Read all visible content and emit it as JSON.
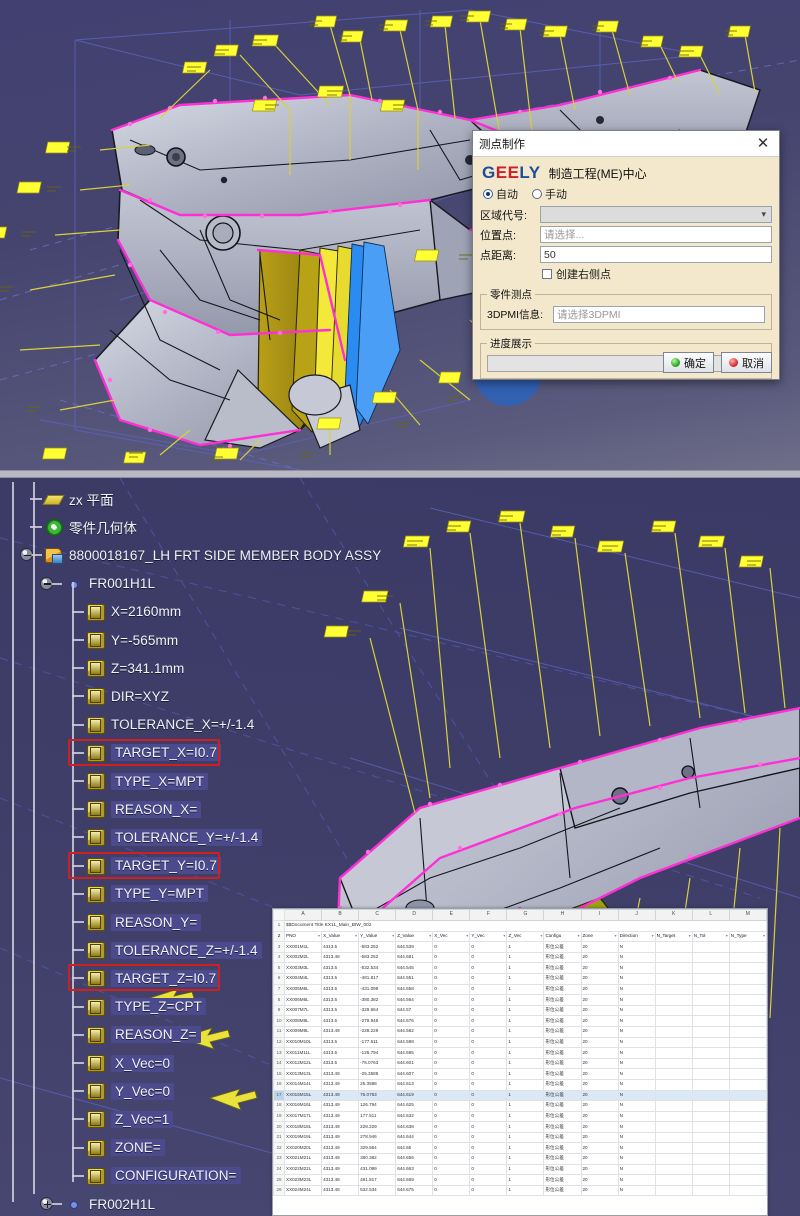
{
  "app": {
    "viewport_top_name": "3d-cad-viewport-top",
    "viewport_bottom_name": "3d-cad-viewport-bottom"
  },
  "dialog": {
    "title": "测点制作",
    "close_label": "✕",
    "brand": "GEELY",
    "brand_cn": "制造工程(ME)中心",
    "mode_auto": "自动",
    "mode_manual": "手动",
    "mode_selected": "自动",
    "zone_label": "区域代号:",
    "zone_value": "",
    "pos_label": "位置点:",
    "pos_placeholder": "请选择...",
    "dist_label": "点距离:",
    "dist_value": "50",
    "create_right_label": "创建右侧点",
    "part_group_label": "零件测点",
    "pmi_label": "3DPMI信息:",
    "pmi_placeholder": "请选择3DPMI",
    "progress_group_label": "进度展示",
    "ok_label": "确定",
    "cancel_label": "取消"
  },
  "tree": {
    "items": [
      {
        "label": "zx 平面",
        "icon": "plane-icon",
        "depth": 1,
        "node": "none",
        "sel": false,
        "red": false
      },
      {
        "label": "零件几何体",
        "icon": "body-icon",
        "depth": 1,
        "node": "none",
        "sel": false,
        "red": false
      },
      {
        "label": "8800018167_LH FRT SIDE MEMBER BODY ASSY",
        "icon": "assembly-icon",
        "depth": 1,
        "node": "minus",
        "sel": false,
        "red": false
      },
      {
        "label": "FR001H1L",
        "icon": "point-icon",
        "depth": 2,
        "node": "minus",
        "sel": false,
        "red": false
      },
      {
        "label": "X=2160mm",
        "icon": "attribute-icon",
        "depth": 3,
        "node": "none",
        "sel": false,
        "red": false
      },
      {
        "label": "Y=-565mm",
        "icon": "attribute-icon",
        "depth": 3,
        "node": "none",
        "sel": false,
        "red": false
      },
      {
        "label": "Z=341.1mm",
        "icon": "attribute-icon",
        "depth": 3,
        "node": "none",
        "sel": false,
        "red": false
      },
      {
        "label": "DIR=XYZ",
        "icon": "attribute-icon",
        "depth": 3,
        "node": "none",
        "sel": false,
        "red": false
      },
      {
        "label": "TOLERANCE_X=+/-1.4",
        "icon": "attribute-icon",
        "depth": 3,
        "node": "none",
        "sel": false,
        "red": false
      },
      {
        "label": "TARGET_X=I0.7",
        "icon": "attribute-icon",
        "depth": 3,
        "node": "none",
        "sel": true,
        "red": true
      },
      {
        "label": "TYPE_X=MPT",
        "icon": "attribute-icon",
        "depth": 3,
        "node": "none",
        "sel": true,
        "red": false
      },
      {
        "label": "REASON_X=",
        "icon": "attribute-icon",
        "depth": 3,
        "node": "none",
        "sel": true,
        "red": false
      },
      {
        "label": "TOLERANCE_Y=+/-1.4",
        "icon": "attribute-icon",
        "depth": 3,
        "node": "none",
        "sel": true,
        "red": false
      },
      {
        "label": "TARGET_Y=I0.7",
        "icon": "attribute-icon",
        "depth": 3,
        "node": "none",
        "sel": true,
        "red": true
      },
      {
        "label": "TYPE_Y=MPT",
        "icon": "attribute-icon",
        "depth": 3,
        "node": "none",
        "sel": true,
        "red": false
      },
      {
        "label": "REASON_Y=",
        "icon": "attribute-icon",
        "depth": 3,
        "node": "none",
        "sel": true,
        "red": false
      },
      {
        "label": "TOLERANCE_Z=+/-1.4",
        "icon": "attribute-icon",
        "depth": 3,
        "node": "none",
        "sel": true,
        "red": false
      },
      {
        "label": "TARGET_Z=I0.7",
        "icon": "attribute-icon",
        "depth": 3,
        "node": "none",
        "sel": true,
        "red": true
      },
      {
        "label": "TYPE_Z=CPT",
        "icon": "attribute-icon",
        "depth": 3,
        "node": "none",
        "sel": true,
        "red": false
      },
      {
        "label": "REASON_Z=",
        "icon": "attribute-icon",
        "depth": 3,
        "node": "none",
        "sel": true,
        "red": false
      },
      {
        "label": "X_Vec=0",
        "icon": "attribute-icon",
        "depth": 3,
        "node": "none",
        "sel": true,
        "red": false
      },
      {
        "label": "Y_Vec=0",
        "icon": "attribute-icon",
        "depth": 3,
        "node": "none",
        "sel": true,
        "red": false
      },
      {
        "label": "Z_Vec=1",
        "icon": "attribute-icon",
        "depth": 3,
        "node": "none",
        "sel": true,
        "red": false
      },
      {
        "label": "ZONE=",
        "icon": "attribute-icon",
        "depth": 3,
        "node": "none",
        "sel": true,
        "red": false
      },
      {
        "label": "CONFIGURATION=",
        "icon": "attribute-icon",
        "depth": 3,
        "node": "none",
        "sel": true,
        "red": false
      },
      {
        "label": "FR002H1L",
        "icon": "point-icon",
        "depth": 2,
        "node": "plus",
        "sel": false,
        "red": false
      }
    ]
  },
  "sheet": {
    "columns": [
      "A",
      "B",
      "C",
      "D",
      "E",
      "F",
      "G",
      "H",
      "I",
      "J",
      "K",
      "L",
      "M"
    ],
    "title_row": "$$Document Title KX11_Main_BIW_002",
    "headers": [
      "PNO",
      "X_Value",
      "Y_Value",
      "Z_Value",
      "X_Vec",
      "Y_Vec",
      "Z_Vec",
      "Configu",
      "Zone",
      "Direction",
      "N_Target",
      "N_Tol",
      "N_Type"
    ],
    "selected_row": 17,
    "rows": [
      {
        "n": 3,
        "cells": [
          "XX001M1L",
          "4313.5",
          "-583.252",
          "644.539",
          "0",
          "0",
          "1",
          "形位公差",
          "20",
          "N",
          "",
          "",
          ""
        ]
      },
      {
        "n": 4,
        "cells": [
          "XX002M2L",
          "4313.48",
          "-583.252",
          "644.681",
          "0",
          "0",
          "1",
          "形位公差",
          "20",
          "N",
          "",
          "",
          ""
        ]
      },
      {
        "n": 5,
        "cells": [
          "XX003M3L",
          "4313.5",
          "-532.534",
          "644.545",
          "0",
          "0",
          "1",
          "形位公差",
          "20",
          "N",
          "",
          "",
          ""
        ]
      },
      {
        "n": 6,
        "cells": [
          "XX004M4L",
          "4313.5",
          "-481.817",
          "644.551",
          "0",
          "0",
          "1",
          "形位公差",
          "20",
          "N",
          "",
          "",
          ""
        ]
      },
      {
        "n": 7,
        "cells": [
          "XX005M5L",
          "4313.5",
          "-431.099",
          "644.558",
          "0",
          "0",
          "1",
          "形位公差",
          "20",
          "N",
          "",
          "",
          ""
        ]
      },
      {
        "n": 8,
        "cells": [
          "XX006M6L",
          "4313.5",
          "-380.382",
          "644.564",
          "0",
          "0",
          "1",
          "形位公差",
          "20",
          "N",
          "",
          "",
          ""
        ]
      },
      {
        "n": 9,
        "cells": [
          "XX007M7L",
          "4313.5",
          "-329.664",
          "644.57",
          "0",
          "0",
          "1",
          "形位公差",
          "20",
          "N",
          "",
          "",
          ""
        ]
      },
      {
        "n": 10,
        "cells": [
          "XX008M8L",
          "4313.5",
          "-279.946",
          "644.576",
          "0",
          "0",
          "1",
          "形位公差",
          "20",
          "N",
          "",
          "",
          ""
        ]
      },
      {
        "n": 11,
        "cells": [
          "XX009M9L",
          "4313.49",
          "-228.229",
          "644.582",
          "0",
          "0",
          "1",
          "形位公差",
          "20",
          "N",
          "",
          "",
          ""
        ]
      },
      {
        "n": 12,
        "cells": [
          "XX010M10L",
          "4313.5",
          "-177.511",
          "644.588",
          "0",
          "0",
          "1",
          "形位公差",
          "20",
          "N",
          "",
          "",
          ""
        ]
      },
      {
        "n": 13,
        "cells": [
          "XX011M11L",
          "4313.5",
          "-126.794",
          "644.595",
          "0",
          "0",
          "1",
          "形位公差",
          "20",
          "N",
          "",
          "",
          ""
        ]
      },
      {
        "n": 14,
        "cells": [
          "XX012M12L",
          "4313.5",
          "-76.0763",
          "644.601",
          "0",
          "0",
          "1",
          "形位公差",
          "20",
          "N",
          "",
          "",
          ""
        ]
      },
      {
        "n": 15,
        "cells": [
          "XX013M13L",
          "4313.49",
          "-25.3588",
          "644.607",
          "0",
          "0",
          "1",
          "形位公差",
          "20",
          "N",
          "",
          "",
          ""
        ]
      },
      {
        "n": 16,
        "cells": [
          "XX014M14L",
          "4313.49",
          "25.3588",
          "644.613",
          "0",
          "0",
          "1",
          "形位公差",
          "20",
          "N",
          "",
          "",
          ""
        ]
      },
      {
        "n": 17,
        "cells": [
          "XX015M15L",
          "4313.49",
          "76.0763",
          "644.619",
          "0",
          "0",
          "1",
          "形位公差",
          "20",
          "N",
          "",
          "",
          ""
        ]
      },
      {
        "n": 18,
        "cells": [
          "XX016M16L",
          "4313.49",
          "126.794",
          "644.625",
          "0",
          "0",
          "1",
          "形位公差",
          "20",
          "N",
          "",
          "",
          ""
        ]
      },
      {
        "n": 19,
        "cells": [
          "XX017M17L",
          "4313.49",
          "177.511",
          "644.632",
          "0",
          "0",
          "1",
          "形位公差",
          "20",
          "N",
          "",
          "",
          ""
        ]
      },
      {
        "n": 20,
        "cells": [
          "XX018M18L",
          "4313.49",
          "228.229",
          "644.638",
          "0",
          "0",
          "1",
          "形位公差",
          "20",
          "N",
          "",
          "",
          ""
        ]
      },
      {
        "n": 21,
        "cells": [
          "XX019M19L",
          "4313.49",
          "278.946",
          "644.644",
          "0",
          "0",
          "1",
          "形位公差",
          "20",
          "N",
          "",
          "",
          ""
        ]
      },
      {
        "n": 22,
        "cells": [
          "XX020M20L",
          "4313.49",
          "329.664",
          "644.65",
          "0",
          "0",
          "1",
          "形位公差",
          "20",
          "N",
          "",
          "",
          ""
        ]
      },
      {
        "n": 23,
        "cells": [
          "XX021M21L",
          "4313.49",
          "380.382",
          "644.656",
          "0",
          "0",
          "1",
          "形位公差",
          "20",
          "N",
          "",
          "",
          ""
        ]
      },
      {
        "n": 24,
        "cells": [
          "XX022M22L",
          "4313.49",
          "431.099",
          "644.663",
          "0",
          "0",
          "1",
          "形位公差",
          "20",
          "N",
          "",
          "",
          ""
        ]
      },
      {
        "n": 25,
        "cells": [
          "XX023M23L",
          "4313.48",
          "481.817",
          "644.669",
          "0",
          "0",
          "1",
          "形位公差",
          "20",
          "N",
          "",
          "",
          ""
        ]
      },
      {
        "n": 26,
        "cells": [
          "XX024M24L",
          "4313.48",
          "532.534",
          "644.675",
          "0",
          "0",
          "1",
          "形位公差",
          "20",
          "N",
          "",
          "",
          ""
        ]
      }
    ]
  },
  "colors": {
    "viewport_bg": "#3f3e69",
    "cad_body": "#b9bcc9",
    "cad_edge_magenta": "#ff2fd6",
    "cad_yellow": "#ffff2a",
    "cad_olive": "#9a8a12",
    "cad_cyan": "#2aa8ff",
    "highlight_red": "#d01f1f",
    "geely_blue": "#1a4f9c"
  }
}
